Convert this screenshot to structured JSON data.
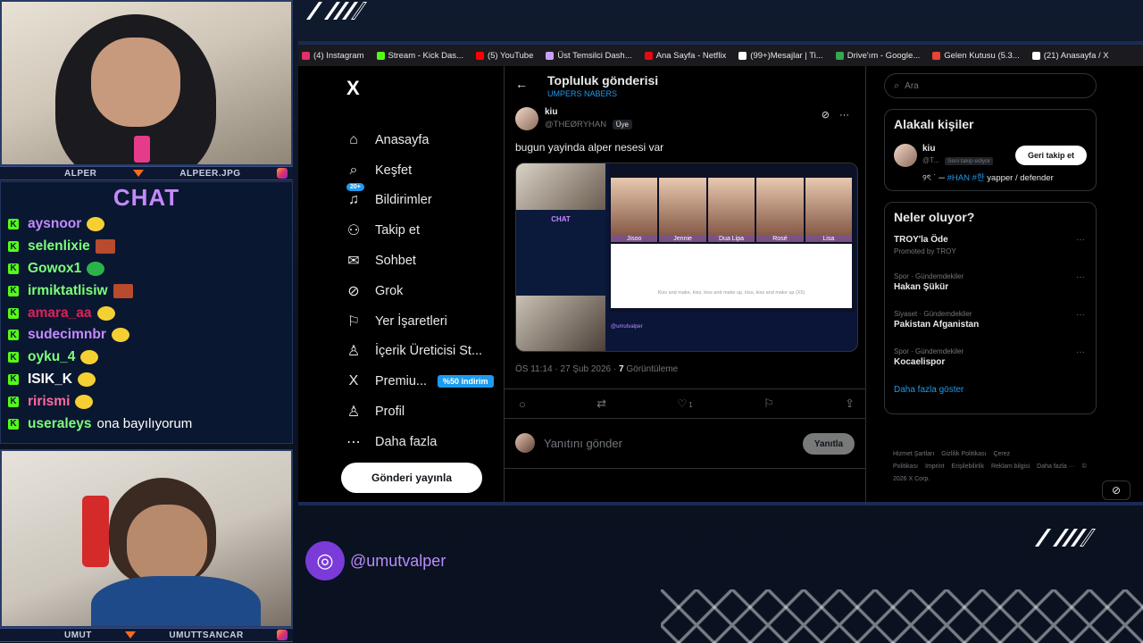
{
  "overlay": {
    "cam_top": {
      "name_left": "ALPER",
      "name_right": "ALPEER.JPG"
    },
    "cam_bottom": {
      "name_left": "UMUT",
      "name_right": "UMUTTSANCAR"
    },
    "chat_title": "CHAT",
    "chat": [
      {
        "user": "aysnoor",
        "color": "#c489ff",
        "msg": "",
        "emote": "banana-emote"
      },
      {
        "user": "selenlixie",
        "color": "#7dff7a",
        "msg": "",
        "emote": "square-emote"
      },
      {
        "user": "Gowox1",
        "color": "#7dff7a",
        "msg": "",
        "emote": "green-emote"
      },
      {
        "user": "irmiktatlisiw",
        "color": "#7dff7a",
        "msg": "",
        "emote": "face-emote"
      },
      {
        "user": "amara_aa",
        "color": "#e0205a",
        "msg": "",
        "emote": "pepe-emote"
      },
      {
        "user": "sudecimnbr",
        "color": "#c489ff",
        "msg": "",
        "emote": "pepe-emote"
      },
      {
        "user": "oyku_4",
        "color": "#7dff7a",
        "msg": "",
        "emote": "pepe-emote"
      },
      {
        "user": "ISIK_K",
        "color": "#ffffff",
        "msg": "",
        "emote": "banana-emote"
      },
      {
        "user": "rirismi",
        "color": "#ff6aa0",
        "msg": "",
        "emote": "pepe-emote"
      },
      {
        "user": "useraleys",
        "color": "#7dff7a",
        "msg": "ona bayılıyorum",
        "emote": ""
      }
    ],
    "social_handle": "@umutvalper"
  },
  "bookmarks": [
    {
      "label": "(4) Instagram",
      "color": "#e1306c"
    },
    {
      "label": "Stream - Kick Das...",
      "color": "#53fc18"
    },
    {
      "label": "(5) YouTube",
      "color": "#ff0000"
    },
    {
      "label": "Üst Temsilci Dash...",
      "color": "#c9a0ff"
    },
    {
      "label": "Ana Sayfa - Netflix",
      "color": "#e50914"
    },
    {
      "label": "(99+)Mesajlar | Ti...",
      "color": "#ffffff"
    },
    {
      "label": "Drive'ım - Google...",
      "color": "#34a853"
    },
    {
      "label": "Gelen Kutusu (5.3...",
      "color": "#ea4335"
    },
    {
      "label": "(21) Anasayfa / X",
      "color": "#ffffff"
    }
  ],
  "x": {
    "logo": "X",
    "nav": [
      {
        "label": "Anasayfa",
        "icon": "home-icon",
        "glyph": "⌂"
      },
      {
        "label": "Keşfet",
        "icon": "search-icon",
        "glyph": "⌕"
      },
      {
        "label": "Bildirimler",
        "icon": "bell-icon",
        "glyph": "♫",
        "badge": "20+"
      },
      {
        "label": "Takip et",
        "icon": "add-person-icon",
        "glyph": "⚇"
      },
      {
        "label": "Sohbet",
        "icon": "mail-icon",
        "glyph": "✉"
      },
      {
        "label": "Grok",
        "icon": "grok-icon",
        "glyph": "⊘"
      },
      {
        "label": "Yer İşaretleri",
        "icon": "bookmark-icon",
        "glyph": "⚐"
      },
      {
        "label": "İçerik Üreticisi St...",
        "icon": "creator-icon",
        "glyph": "♙"
      },
      {
        "label": "Premiu...",
        "icon": "x-premium-icon",
        "glyph": "X",
        "promo": "%50 indirim"
      },
      {
        "label": "Profil",
        "icon": "profile-icon",
        "glyph": "♙"
      },
      {
        "label": "Daha fazla",
        "icon": "more-icon",
        "glyph": "⋯"
      }
    ],
    "post_button": "Gönderi yayınla",
    "main": {
      "title": "Topluluk gönderisi",
      "subtitle": "UMPERS NABERS",
      "tweet": {
        "name": "kiu",
        "handle": "@THEØRYHAN",
        "role": "Üye",
        "text": "bugun yayinda alper nesesi var",
        "media": {
          "chat_title": "CHAT",
          "people": [
            "Jisoo",
            "Jennie",
            "Dua Lipa",
            "Rosé",
            "Lisa"
          ],
          "lyric": "Kiss and make, kiss, kiss and make up, kiss, kiss and make up (X5)",
          "handle": "@umutvalper"
        },
        "time": "ÖS 11:14 · 27 Şub 2026 ·",
        "views": "7",
        "views_label": "Görüntüleme",
        "likes": "1"
      },
      "reply_placeholder": "Yanıtını gönder",
      "reply_button": "Yanıtla"
    },
    "right": {
      "search_placeholder": "Ara",
      "related_title": "Alakalı kişiler",
      "related": {
        "name": "kiu",
        "handle": "@T...",
        "follows_you": "Seni takip ediyor",
        "button": "Geri takip et",
        "bio_prefix": "୨ৎ ˙ ─",
        "bio_tag": "#HAN #한",
        "bio_suffix": "yapper / defender"
      },
      "trends_title": "Neler oluyor?",
      "trends": [
        {
          "context": "",
          "name": "TROY'la Öde",
          "promoted": "Promoted by TROY"
        },
        {
          "context": "Spor · Gündemdekiler",
          "name": "Hakan Şükür",
          "promoted": ""
        },
        {
          "context": "Siyaset · Gündemdekiler",
          "name": "Pakistan Afganistan",
          "promoted": ""
        },
        {
          "context": "Spor · Gündemdekiler",
          "name": "Kocaelispor",
          "promoted": ""
        }
      ],
      "show_more": "Daha fazla göster",
      "footer": [
        "Hizmet Şartları",
        "Gizlilik Politikası",
        "Çerez Politikası",
        "Imprint",
        "Erişilebilirlik",
        "Reklam bilgisi",
        "Daha fazla ···",
        "© 2026 X Corp."
      ]
    }
  }
}
